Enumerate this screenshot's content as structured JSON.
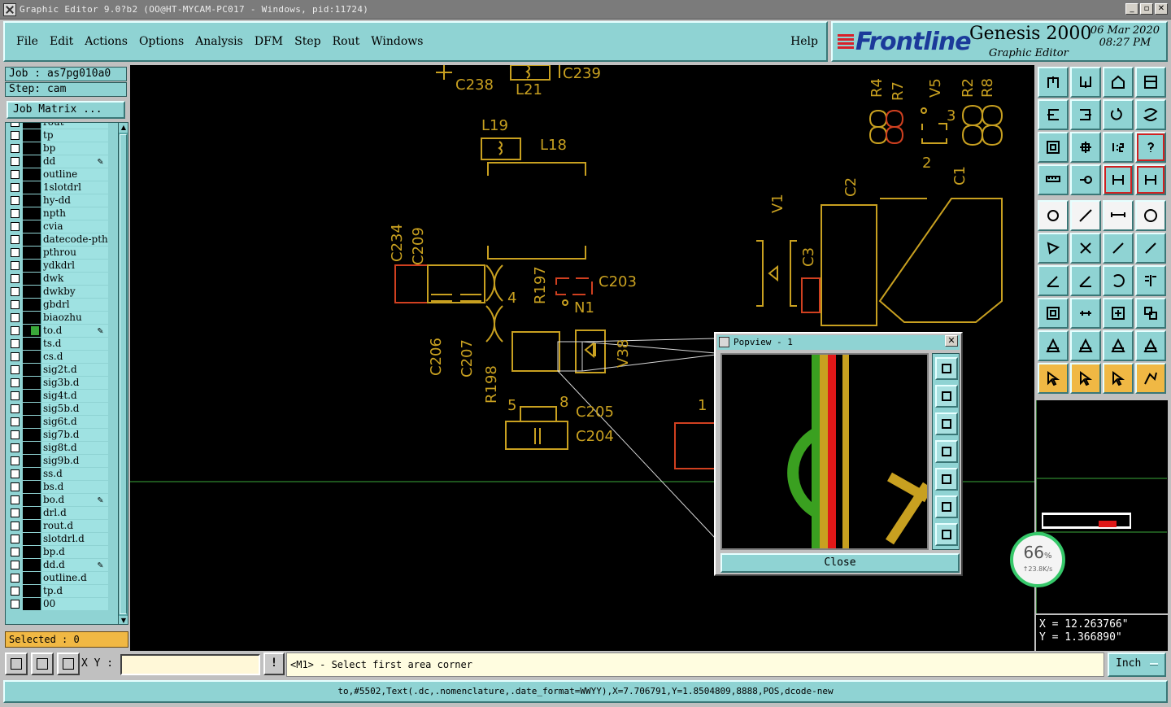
{
  "window": {
    "title": "Graphic Editor 9.0?b2 (OO@HT-MYCAM-PC017 - Windows, pid:11724)",
    "buttons": [
      "_",
      "▫",
      "✕"
    ]
  },
  "menu": {
    "items": [
      "File",
      "Edit",
      "Actions",
      "Options",
      "Analysis",
      "DFM",
      "Step",
      "Rout",
      "Windows"
    ],
    "help": "Help"
  },
  "brand": {
    "logo": "Frontline",
    "product": "Genesis 2000",
    "subtitle": "Graphic Editor",
    "date": "06 Mar 2020",
    "time": "08:27 PM"
  },
  "job": {
    "job_label": "Job : as7pg010a0",
    "step_label": "Step: cam",
    "matrix_button": "Job Matrix ..."
  },
  "layers": [
    {
      "name": "rout",
      "affected": false,
      "edit": false,
      "partial": true
    },
    {
      "name": "tp",
      "affected": false,
      "edit": false
    },
    {
      "name": "bp",
      "affected": false,
      "edit": false
    },
    {
      "name": "dd",
      "affected": false,
      "edit": true
    },
    {
      "name": "outline",
      "affected": false,
      "edit": false
    },
    {
      "name": "1slotdrl",
      "affected": false,
      "edit": false
    },
    {
      "name": "hy-dd",
      "affected": false,
      "edit": false
    },
    {
      "name": "npth",
      "affected": false,
      "edit": false
    },
    {
      "name": "cvia",
      "affected": false,
      "edit": false
    },
    {
      "name": "datecode-pth",
      "affected": false,
      "edit": false
    },
    {
      "name": "pthrou",
      "affected": false,
      "edit": false
    },
    {
      "name": "ydkdrl",
      "affected": false,
      "edit": false
    },
    {
      "name": "dwk",
      "affected": false,
      "edit": false
    },
    {
      "name": "dwkby",
      "affected": false,
      "edit": false
    },
    {
      "name": "gbdrl",
      "affected": false,
      "edit": false
    },
    {
      "name": "biaozhu",
      "affected": false,
      "edit": false
    },
    {
      "name": "to.d",
      "affected": true,
      "edit": true
    },
    {
      "name": "ts.d",
      "affected": false,
      "edit": false
    },
    {
      "name": "cs.d",
      "affected": false,
      "edit": false
    },
    {
      "name": "sig2t.d",
      "affected": false,
      "edit": false
    },
    {
      "name": "sig3b.d",
      "affected": false,
      "edit": false
    },
    {
      "name": "sig4t.d",
      "affected": false,
      "edit": false
    },
    {
      "name": "sig5b.d",
      "affected": false,
      "edit": false
    },
    {
      "name": "sig6t.d",
      "affected": false,
      "edit": false
    },
    {
      "name": "sig7b.d",
      "affected": false,
      "edit": false
    },
    {
      "name": "sig8t.d",
      "affected": false,
      "edit": false
    },
    {
      "name": "sig9b.d",
      "affected": false,
      "edit": false
    },
    {
      "name": "ss.d",
      "affected": false,
      "edit": false
    },
    {
      "name": "bs.d",
      "affected": false,
      "edit": false
    },
    {
      "name": "bo.d",
      "affected": false,
      "edit": true
    },
    {
      "name": "drl.d",
      "affected": false,
      "edit": false
    },
    {
      "name": "rout.d",
      "affected": false,
      "edit": false
    },
    {
      "name": "slotdrl.d",
      "affected": false,
      "edit": false
    },
    {
      "name": "bp.d",
      "affected": false,
      "edit": false
    },
    {
      "name": "dd.d",
      "affected": false,
      "edit": true
    },
    {
      "name": "outline.d",
      "affected": false,
      "edit": false
    },
    {
      "name": "tp.d",
      "affected": false,
      "edit": false
    },
    {
      "name": "00",
      "affected": false,
      "edit": false
    }
  ],
  "selected": "Selected : 0",
  "canvas_labels": [
    "C238",
    "L21",
    "C239",
    "L19",
    "L18",
    "R4",
    "R7",
    "V5",
    "R2",
    "R8",
    "3",
    "2",
    "C1",
    "C2",
    "V1",
    "C3",
    "C234",
    "C209",
    "R197",
    "C203",
    "N1",
    "4",
    "C206",
    "C207",
    "R198",
    "V38",
    "5",
    "8",
    "C205",
    "C204",
    "1"
  ],
  "popview": {
    "title": "Popview - 1",
    "close_label": "Close",
    "tools": [
      "zoom-fit-icon",
      "pan-up-icon",
      "pan-down-icon",
      "pan-left-icon",
      "pan-right-icon",
      "zoom-in-icon",
      "zoom-out-icon"
    ]
  },
  "toolbox": {
    "rows": [
      [
        "pan-up-icon",
        "pan-down-icon",
        "home-icon",
        "window-icon"
      ],
      [
        "pan-left-icon",
        "pan-right-icon",
        "redraw-icon",
        "s-curve-icon"
      ],
      [
        "zoom-fit-icon",
        "zoom-center-icon",
        "scale-1-2-icon",
        "help-icon"
      ],
      [
        "ruler-icon",
        "snap-icon",
        "measure-icon",
        "measure-icon"
      ],
      [
        "pad-icon",
        "line-icon",
        "dimension-icon",
        "circle-icon"
      ],
      [
        "surface-icon",
        "cross-icon",
        "segment-icon",
        "segment-icon"
      ],
      [
        "angle-icon",
        "angle-icon",
        "arc-icon",
        "mirror-icon"
      ],
      [
        "move-icon",
        "align-icon",
        "snap-center-icon",
        "group-icon"
      ],
      [
        "triangle-icon",
        "triangle-icon",
        "triangle-icon",
        "triangle-icon"
      ],
      [
        "pointer-icon",
        "select-icon",
        "select-circle-icon",
        "select-path-icon"
      ]
    ]
  },
  "coords": {
    "x": "X = 12.263766\"",
    "y": "Y = 1.366890\""
  },
  "speed_widget": {
    "percent": "66",
    "unit": "%",
    "rate": "↑23.8K/s"
  },
  "bottom": {
    "xy_label": "X Y :",
    "xy_value": "",
    "bang": "!",
    "prompt": "<M1> - Select first area corner",
    "unit": "Inch"
  },
  "status": "to,#5502,Text(.dc,.nomenclature,.date_format=WWYY),X=7.706791,Y=1.8504809,8888,POS,dcode-new",
  "colors": {
    "panel": "#8fd3d3",
    "canvas": "#000000",
    "silkscreen": "#c8a020",
    "copper": "#d04020",
    "highlight_green": "#3aa83a"
  }
}
